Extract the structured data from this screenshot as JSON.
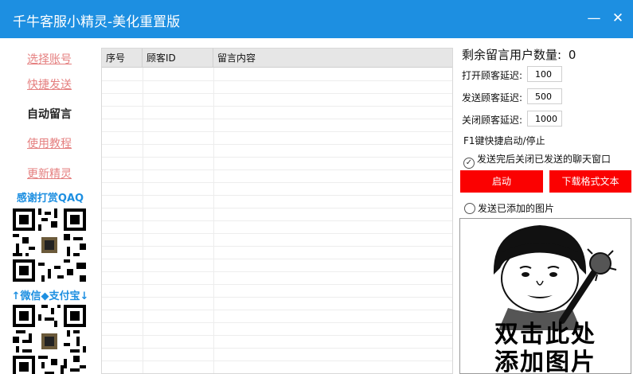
{
  "window": {
    "title": "千牛客服小精灵-美化重置版",
    "minimize": "—",
    "close": "✕",
    "accent": "#1d8fe1"
  },
  "sidebar": {
    "items": [
      {
        "label": "选择账号",
        "state": "link"
      },
      {
        "label": "快捷发送",
        "state": "link"
      },
      {
        "label": "自动留言",
        "state": "active"
      },
      {
        "label": "使用教程",
        "state": "link"
      },
      {
        "label": "更新精灵",
        "state": "link"
      }
    ],
    "thanks": "感谢打赏QAQ",
    "payment_label": "↑微信◆支付宝↓"
  },
  "table": {
    "columns": [
      "序号",
      "顾客ID",
      "留言内容"
    ],
    "rows": []
  },
  "settings": {
    "remaining_label": "剩余留言用户数量:",
    "remaining_value": "0",
    "open_delay_label": "打开顾客延迟:",
    "open_delay_value": "100",
    "send_delay_label": "发送顾客延迟:",
    "send_delay_value": "500",
    "close_delay_label": "关闭顾客延迟:",
    "close_delay_value": "1000",
    "hotkey_hint": "F1键快捷启动/停止",
    "close_after_send_label": "发送完后关闭已发送的聊天窗口",
    "close_after_send_checked": true,
    "start_button": "启动",
    "download_button": "下载格式文本",
    "send_image_label": "发送已添加的图片",
    "send_image_checked": false,
    "image_caption_line1": "双击此处",
    "image_caption_line2": "添加图片",
    "button_color": "#fb0101"
  }
}
